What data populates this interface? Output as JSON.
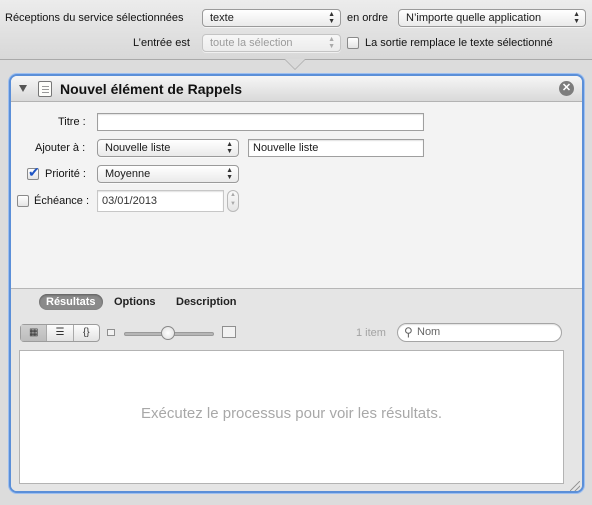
{
  "service_bar": {
    "receives_label": "Réceptions du service sélectionnées",
    "input_type_value": "texte",
    "in_label": "en ordre",
    "application_value": "N’importe quelle application",
    "input_is_label": "L’entrée est",
    "input_is_value": "toute la sélection",
    "replace_label": "La sortie remplace le texte sélectionné"
  },
  "action": {
    "title": "Nouvel élément de Rappels",
    "close_glyph": "✕",
    "fields": {
      "title_label": "Titre :",
      "title_value": "",
      "add_to_label": "Ajouter à :",
      "add_to_value": "Nouvelle liste",
      "new_list_value": "Nouvelle liste",
      "priority_label": "Priorité :",
      "priority_value": "Moyenne",
      "priority_checked": true,
      "due_label": "Échéance :",
      "due_value": "03/01/2013",
      "due_checked": false
    },
    "results": {
      "tabs": [
        "Résultats",
        "Options",
        "Description"
      ],
      "active_tab": "Résultats",
      "view_icons": [
        "icon-view-icon",
        "list-view-icon",
        "code-view-icon"
      ],
      "view_glyphs": [
        "▦",
        "☰",
        "{}"
      ],
      "item_count": "1 item",
      "search_placeholder": "Nom",
      "message": "Exécutez le processus pour voir les résultats."
    }
  },
  "colors": {
    "selection_border": "#5b8fd8",
    "checkbox_check": "#1f55c4"
  }
}
